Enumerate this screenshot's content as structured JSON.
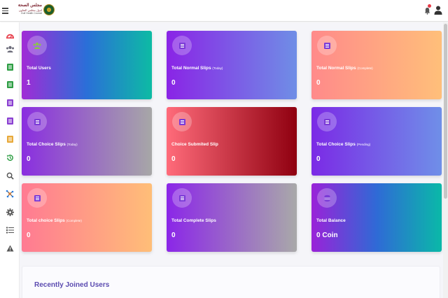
{
  "header": {
    "logo": {
      "line1": "مجلس الصحة",
      "line2": "لدول مجلس التعاون",
      "line3": "Gulf Health Council"
    },
    "notification_count": ""
  },
  "sidebar": {
    "items": [
      {
        "icon": "dashboard-icon",
        "color": "#e8434f"
      },
      {
        "icon": "users-icon",
        "color": "#6c6c7a"
      },
      {
        "icon": "slip-icon",
        "color": "#2e9e44"
      },
      {
        "icon": "slip-icon",
        "color": "#2e9e44"
      },
      {
        "icon": "slip-icon",
        "color": "#8a3fd1"
      },
      {
        "icon": "slip-icon",
        "color": "#8a3fd1"
      },
      {
        "icon": "slip-icon",
        "color": "#e8a93a"
      },
      {
        "icon": "history-icon",
        "color": "#2e9e44"
      },
      {
        "icon": "search-icon",
        "color": "#555555"
      },
      {
        "icon": "network-icon",
        "color": "#e07a2e"
      },
      {
        "icon": "gear-icon",
        "color": "#555555"
      },
      {
        "icon": "list-icon",
        "color": "#555555"
      },
      {
        "icon": "warning-icon",
        "color": "#555555"
      }
    ]
  },
  "cards": [
    {
      "title": "Total Users",
      "sub": "",
      "value": "1",
      "icon": "users-icon",
      "gradient": [
        "#a12bd6",
        "#2a6fd8",
        "#0dbba4"
      ]
    },
    {
      "title": "Total Normal Slips",
      "sub": "(Today)",
      "value": "0",
      "icon": "slip-icon",
      "gradient": [
        "#8a24e6",
        "#6f8ee6"
      ]
    },
    {
      "title": "Total Normal Slips",
      "sub": "(Complete)",
      "value": "0",
      "icon": "slip-icon",
      "gradient": [
        "#ff8a8a",
        "#ffbf7a"
      ]
    },
    {
      "title": "Total Choice Slips",
      "sub": "(Today)",
      "value": "0",
      "icon": "slip-icon",
      "gradient": [
        "#8a2ee0",
        "#a7a7a7"
      ]
    },
    {
      "title": "Choice Submited Slip",
      "sub": "",
      "value": "0",
      "icon": "slip-icon",
      "gradient": [
        "#ff6b7a",
        "#8f0010"
      ]
    },
    {
      "title": "Total Choice Slips",
      "sub": "(Pending)",
      "value": "0",
      "icon": "slip-icon",
      "gradient": [
        "#7b2ae6",
        "#6f8fe8"
      ]
    },
    {
      "title": "Total choice Slips",
      "sub": "(Complete)",
      "value": "0",
      "icon": "slip-icon",
      "gradient": [
        "#ff7a92",
        "#ffbe78"
      ]
    },
    {
      "title": "Total Complete Slips",
      "sub": "",
      "value": "0",
      "icon": "slip-icon",
      "gradient": [
        "#8b26e8",
        "#a9a9a9"
      ]
    },
    {
      "title": "Total Balance",
      "sub": "",
      "value": "0 Coin",
      "icon": "coins-icon",
      "gradient": [
        "#9a22d8",
        "#2f6ad6",
        "#0ab9a8"
      ]
    }
  ],
  "recent": {
    "title": "Recently Joined Users"
  }
}
